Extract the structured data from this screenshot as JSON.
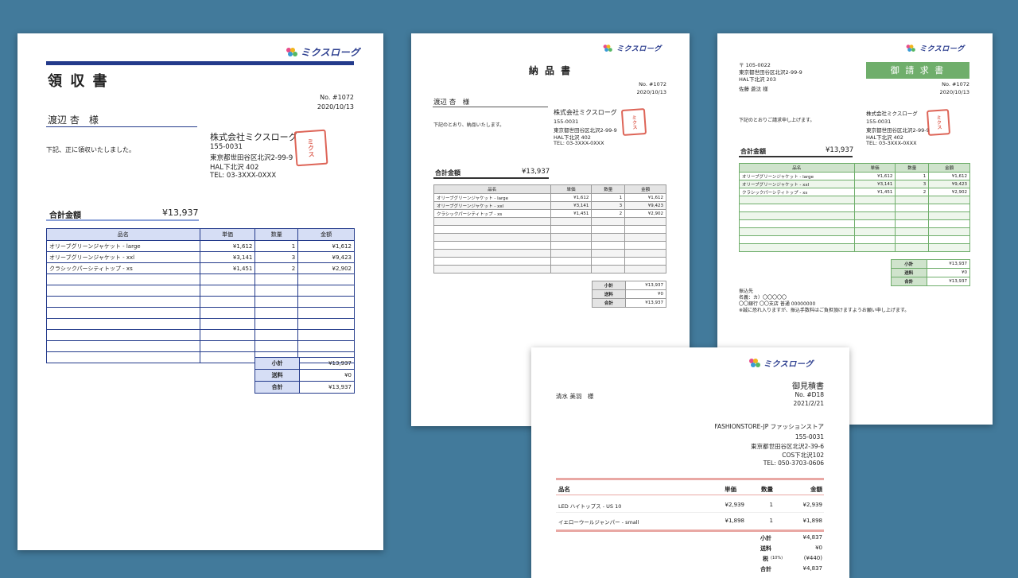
{
  "brand": {
    "logo_text": "ミクスローグ",
    "colors": {
      "background": "#427a9b",
      "receipt_accent": "#233a8b",
      "invoice_accent": "#6fae6b",
      "quote_accent": "#e9a8a4",
      "stamp": "#d84a3a"
    }
  },
  "receipt": {
    "title": "領 収 書",
    "number": "No. #1072",
    "date": "2020/10/13",
    "customer": "渡辺 杏　様",
    "message": "下記、正に領収いたしました。",
    "company": "株式会社ミクスローグ",
    "zip": "155-0031",
    "address": "東京都世田谷区北沢2-99-9",
    "building": "HAL下北沢 402",
    "tel": "TEL: 03-3XXX-0XXX",
    "total_label": "合計金額",
    "total_value": "¥13,937",
    "headers": [
      "品名",
      "単価",
      "数量",
      "金額"
    ],
    "rows": [
      [
        "オリーブグリーンジャケット - large",
        "¥1,612",
        "1",
        "¥1,612"
      ],
      [
        "オリーブグリーンジャケット - xxl",
        "¥3,141",
        "3",
        "¥9,423"
      ],
      [
        "クラシックパーシティトップ - xs",
        "¥1,451",
        "2",
        "¥2,902"
      ],
      [
        "",
        "",
        "",
        ""
      ],
      [
        "",
        "",
        "",
        ""
      ],
      [
        "",
        "",
        "",
        ""
      ],
      [
        "",
        "",
        "",
        ""
      ],
      [
        "",
        "",
        "",
        ""
      ],
      [
        "",
        "",
        "",
        ""
      ],
      [
        "",
        "",
        "",
        ""
      ],
      [
        "",
        "",
        "",
        ""
      ]
    ],
    "summary": [
      [
        "小計",
        "¥13,937"
      ],
      [
        "送料",
        "¥0"
      ],
      [
        "合計",
        "¥13,937"
      ]
    ]
  },
  "delivery": {
    "title": "納 品 書",
    "number": "No. #1072",
    "date": "2020/10/13",
    "customer": "渡辺 杏　様",
    "message": "下記のとおり、納品いたします。",
    "company": "株式会社ミクスローグ",
    "zip": "155-0031",
    "address": "東京都世田谷区北沢2-99-9",
    "building": "HAL下北沢 402",
    "tel": "TEL: 03-3XXX-0XXX",
    "total_label": "合計金額",
    "total_value": "¥13,937",
    "headers": [
      "品名",
      "単価",
      "数量",
      "金額"
    ],
    "rows": [
      [
        "オリーブグリーンジャケット - large",
        "¥1,612",
        "1",
        "¥1,612"
      ],
      [
        "オリーブグリーンジャケット - xxl",
        "¥3,141",
        "3",
        "¥9,423"
      ],
      [
        "クラシックパーシティトップ - xs",
        "¥1,451",
        "2",
        "¥2,902"
      ],
      [
        "",
        "",
        "",
        ""
      ],
      [
        "",
        "",
        "",
        ""
      ],
      [
        "",
        "",
        "",
        ""
      ],
      [
        "",
        "",
        "",
        ""
      ],
      [
        "",
        "",
        "",
        ""
      ],
      [
        "",
        "",
        "",
        ""
      ],
      [
        "",
        "",
        "",
        ""
      ]
    ],
    "summary": [
      [
        "小計",
        "¥13,937"
      ],
      [
        "送料",
        "¥0"
      ],
      [
        "合計",
        "¥13,937"
      ]
    ]
  },
  "invoice": {
    "title": "御 請 求 書",
    "number": "No. #1072",
    "date": "2020/10/13",
    "to_zip": "〒 105-0022",
    "to_address": "東京都世田谷区北沢2-99-9",
    "to_building": "HAL下北沢 203",
    "customer": "佐藤 蒼汰 様",
    "message": "下記のとおりご請求申し上げます。",
    "company": "株式会社ミクスローグ",
    "zip": "155-0031",
    "address": "東京都世田谷区北沢2-99-9",
    "building": "HAL下北沢 402",
    "tel": "TEL: 03-3XXX-0XXX",
    "total_label": "合計金額",
    "total_value": "¥13,937",
    "headers": [
      "品名",
      "単価",
      "数量",
      "金額"
    ],
    "rows": [
      [
        "オリーブグリーンジャケット - large",
        "¥1,612",
        "1",
        "¥1,612"
      ],
      [
        "オリーブグリーンジャケット - xxl",
        "¥3,141",
        "3",
        "¥9,423"
      ],
      [
        "クラシックパーシティトップ - xs",
        "¥1,451",
        "2",
        "¥2,902"
      ],
      [
        "",
        "",
        "",
        ""
      ],
      [
        "",
        "",
        "",
        ""
      ],
      [
        "",
        "",
        "",
        ""
      ],
      [
        "",
        "",
        "",
        ""
      ],
      [
        "",
        "",
        "",
        ""
      ],
      [
        "",
        "",
        "",
        ""
      ],
      [
        "",
        "",
        "",
        ""
      ]
    ],
    "summary": [
      [
        "小計",
        "¥13,937"
      ],
      [
        "送料",
        "¥0"
      ],
      [
        "合計",
        "¥13,937"
      ]
    ],
    "bank_title": "振込先",
    "bank_name": "名義：カ）〇〇〇〇〇",
    "bank_account": "〇〇銀行 〇〇支店 普通 00000000",
    "bank_note": "※誠に恐れ入りますが、振込手数料はご負担頂けますようお願い申し上げます。"
  },
  "quote": {
    "title": "御見積書",
    "number": "No. #D18",
    "date": "2021/2/21",
    "customer": "清水 美羽　様",
    "company": "FASHIONSTORE-JP ファッションストア",
    "zip": "155-0031",
    "address": "東京都世田谷区北沢2-39-6",
    "building": "COS下北沢102",
    "tel": "TEL: 050-3703-0606",
    "headers": [
      "品名",
      "単価",
      "数量",
      "金額"
    ],
    "rows": [
      [
        "LED ハイトップス - US 10",
        "¥2,939",
        "1",
        "¥2,939"
      ],
      [
        "イエローウールジャンパー - small",
        "¥1,898",
        "1",
        "¥1,898"
      ]
    ],
    "summary": [
      [
        "小計",
        "",
        "¥4,837"
      ],
      [
        "送料",
        "",
        "¥0"
      ],
      [
        "税",
        "(10%)",
        "(¥440)"
      ],
      [
        "合計",
        "",
        "¥4,837"
      ]
    ]
  }
}
